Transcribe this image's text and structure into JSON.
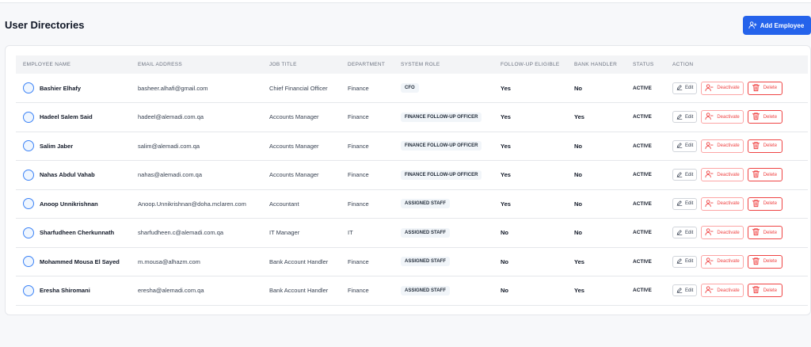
{
  "header": {
    "title": "User Directories",
    "add_button_label": "Add Employee"
  },
  "table": {
    "columns": [
      "EMPLOYEE NAME",
      "EMAIL ADDRESS",
      "JOB TITLE",
      "DEPARTMENT",
      "SYSTEM ROLE",
      "FOLLOW-UP ELIGIBLE",
      "BANK HANDLER",
      "STATUS",
      "ACTION"
    ],
    "rows": [
      {
        "name": "Bashier Elhafy",
        "email": "basheer.alhafi@gmail.com",
        "job": "Chief Financial Officer",
        "dept": "Finance",
        "role": "CFO",
        "followup": "Yes",
        "bank": "No",
        "status": "ACTIVE"
      },
      {
        "name": "Hadeel Salem Said",
        "email": "hadeel@alemadi.com.qa",
        "job": "Accounts Manager",
        "dept": "Finance",
        "role": "FINANCE FOLLOW-UP OFFICER",
        "followup": "Yes",
        "bank": "Yes",
        "status": "ACTIVE"
      },
      {
        "name": "Salim Jaber",
        "email": "salim@alemadi.com.qa",
        "job": "Accounts Manager",
        "dept": "Finance",
        "role": "FINANCE FOLLOW-UP OFFICER",
        "followup": "Yes",
        "bank": "No",
        "status": "ACTIVE"
      },
      {
        "name": "Nahas Abdul Vahab",
        "email": "nahas@alemadi.com.qa",
        "job": "Accounts Manager",
        "dept": "Finance",
        "role": "FINANCE FOLLOW-UP OFFICER",
        "followup": "Yes",
        "bank": "No",
        "status": "ACTIVE"
      },
      {
        "name": "Anoop Unnikrishnan",
        "email": "Anoop.Unnikrishnan@doha.mclaren.com",
        "job": "Accountant",
        "dept": "Finance",
        "role": "ASSIGNED STAFF",
        "followup": "Yes",
        "bank": "No",
        "status": "ACTIVE"
      },
      {
        "name": "Sharfudheen Cherkunnath",
        "email": "sharfudheen.c@alemadi.com.qa",
        "job": "IT Manager",
        "dept": "IT",
        "role": "ASSIGNED STAFF",
        "followup": "No",
        "bank": "No",
        "status": "ACTIVE"
      },
      {
        "name": "Mohammed Mousa El Sayed",
        "email": "m.mousa@alhazm.com",
        "job": "Bank Account Handler",
        "dept": "Finance",
        "role": "ASSIGNED STAFF",
        "followup": "No",
        "bank": "Yes",
        "status": "ACTIVE"
      },
      {
        "name": "Eresha Shiromani",
        "email": "eresha@alemadi.com.qa",
        "job": "Bank Account Handler",
        "dept": "Finance",
        "role": "ASSIGNED STAFF",
        "followup": "No",
        "bank": "Yes",
        "status": "ACTIVE"
      }
    ],
    "actions": {
      "edit": "Edit",
      "deactivate": "Deactivate",
      "delete": "Delete"
    }
  },
  "colors": {
    "primary": "#2563eb",
    "danger": "#ef4444"
  },
  "icons": {
    "add": "user-plus-icon",
    "edit": "pencil-icon",
    "deactivate": "user-minus-icon",
    "delete": "trash-icon"
  }
}
